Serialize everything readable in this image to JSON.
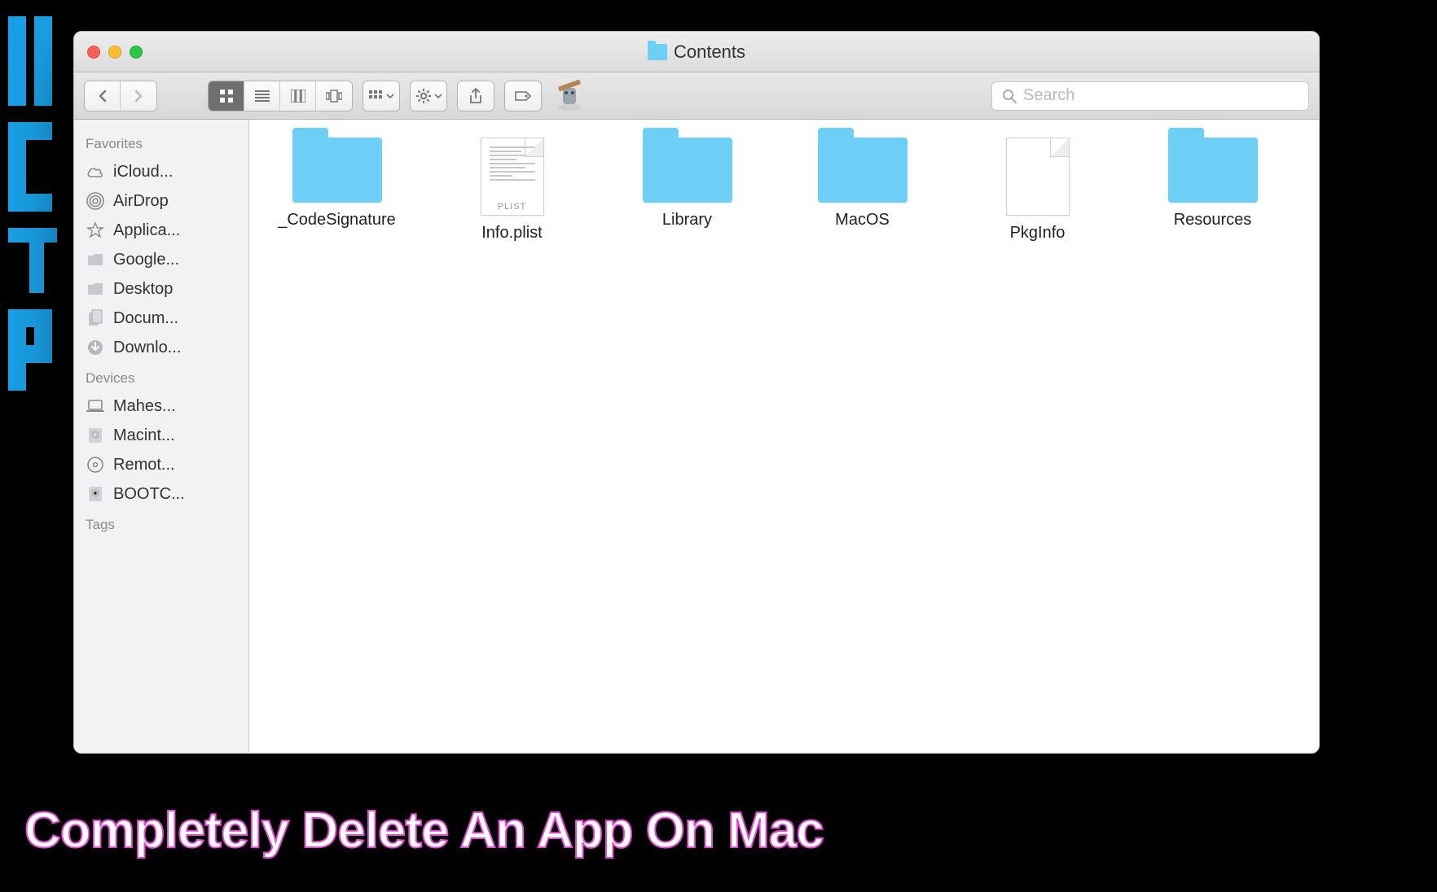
{
  "caption": "Completely Delete An App On Mac",
  "window": {
    "title": "Contents"
  },
  "search": {
    "placeholder": "Search"
  },
  "sidebar": {
    "sections": [
      {
        "header": "Favorites",
        "items": [
          {
            "icon": "cloud",
            "label": "iCloud..."
          },
          {
            "icon": "airdrop",
            "label": "AirDrop"
          },
          {
            "icon": "appstore",
            "label": "Applica..."
          },
          {
            "icon": "folder",
            "label": "Google..."
          },
          {
            "icon": "desktop",
            "label": "Desktop"
          },
          {
            "icon": "doc",
            "label": "Docum..."
          },
          {
            "icon": "download",
            "label": "Downlo..."
          }
        ]
      },
      {
        "header": "Devices",
        "items": [
          {
            "icon": "laptop",
            "label": "Mahes..."
          },
          {
            "icon": "hdd",
            "label": "Macint..."
          },
          {
            "icon": "disc",
            "label": "Remot..."
          },
          {
            "icon": "hdd",
            "label": "BOOTC..."
          }
        ]
      },
      {
        "header": "Tags",
        "items": []
      }
    ]
  },
  "files": [
    {
      "type": "folder",
      "name": "_CodeSignature"
    },
    {
      "type": "plist",
      "name": "Info.plist"
    },
    {
      "type": "folder",
      "name": "Library"
    },
    {
      "type": "folder",
      "name": "MacOS"
    },
    {
      "type": "blank",
      "name": "PkgInfo"
    },
    {
      "type": "folder",
      "name": "Resources"
    }
  ]
}
